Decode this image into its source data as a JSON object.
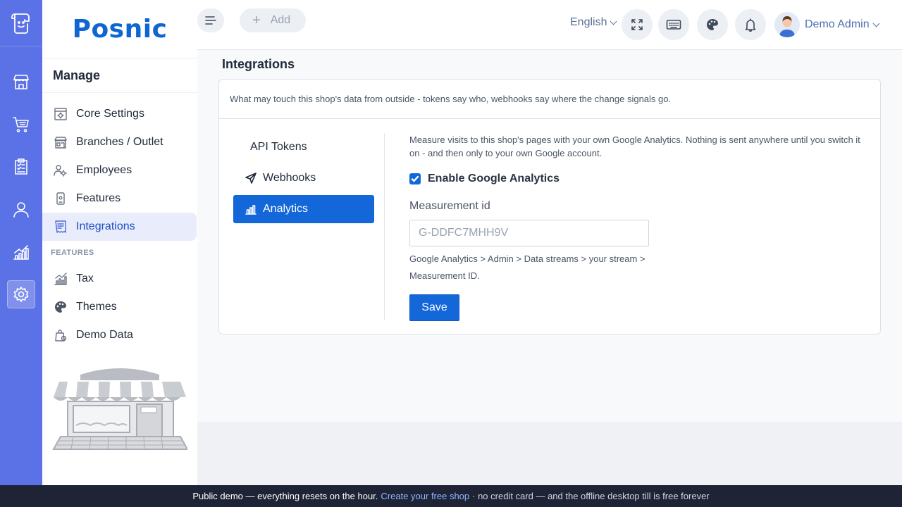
{
  "app": {
    "brand": "Posnic"
  },
  "rail": {
    "items": [
      {
        "id": "store",
        "icon": "storefront-icon"
      },
      {
        "id": "cart",
        "icon": "cart-icon"
      },
      {
        "id": "reports",
        "icon": "clipboard-icon"
      },
      {
        "id": "users",
        "icon": "user-icon"
      },
      {
        "id": "analytics",
        "icon": "bar-chart-icon"
      },
      {
        "id": "settings",
        "icon": "gear-icon",
        "active": true
      }
    ]
  },
  "sidebar": {
    "heading": "Manage",
    "items": [
      {
        "label": "Core Settings",
        "icon": "settings-doc-icon"
      },
      {
        "label": "Branches / Outlet",
        "icon": "store-icon"
      },
      {
        "label": "Employees",
        "icon": "employees-icon"
      },
      {
        "label": "Features",
        "icon": "device-icon"
      },
      {
        "label": "Integrations",
        "icon": "receipt-icon",
        "active": true
      }
    ],
    "section_label": "FEATURES",
    "feature_items": [
      {
        "label": "Tax",
        "icon": "tax-chart-icon"
      },
      {
        "label": "Themes",
        "icon": "palette-icon"
      },
      {
        "label": "Demo Data",
        "icon": "demo-bag-icon"
      }
    ]
  },
  "topbar": {
    "add_label": "Add",
    "language": "English",
    "user_name": "Demo Admin"
  },
  "page": {
    "title": "Integrations",
    "description": "What may touch this shop's data from outside - tokens say who, webhooks say where the change signals go.",
    "tabs": [
      {
        "label": "API Tokens",
        "icon": ""
      },
      {
        "label": "Webhooks",
        "icon": "send-icon"
      },
      {
        "label": "Analytics",
        "icon": "bar-chart-icon",
        "active": true
      }
    ],
    "analytics": {
      "description": "Measure visits to this shop's pages with your own Google Analytics. Nothing is sent anywhere until you switch it on - and then only to your own Google account.",
      "enable_label": "Enable Google Analytics",
      "enabled": true,
      "field_label": "Measurement id",
      "field_placeholder": "G-DDFC7MHH9V",
      "field_value": "",
      "hint": "Google Analytics > Admin > Data streams > your stream > Measurement ID.",
      "save_label": "Save"
    }
  },
  "banner": {
    "text": "Public demo — everything resets on the hour.",
    "link": "Create your free shop",
    "suffix": "· no credit card — and the offline desktop till is free forever"
  },
  "colors": {
    "rail": "#5b72e6",
    "primary": "#1367d8",
    "brand": "#0f66d0"
  }
}
